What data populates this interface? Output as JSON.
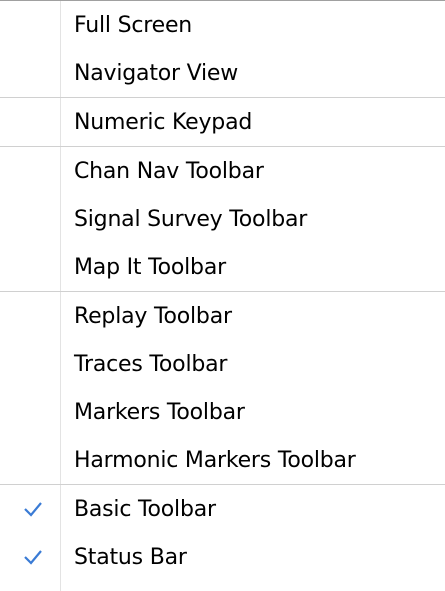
{
  "menu": {
    "check_color": "#3a7bd5",
    "items": [
      {
        "label": "Full Screen",
        "checked": false
      },
      {
        "label": "Navigator View",
        "checked": false
      },
      {
        "label": "Numeric Keypad",
        "checked": false
      },
      {
        "label": "Chan Nav Toolbar",
        "checked": false
      },
      {
        "label": "Signal Survey Toolbar",
        "checked": false
      },
      {
        "label": "Map It Toolbar",
        "checked": false
      },
      {
        "label": "Replay Toolbar",
        "checked": false
      },
      {
        "label": "Traces Toolbar",
        "checked": false
      },
      {
        "label": "Markers Toolbar",
        "checked": false
      },
      {
        "label": "Harmonic Markers Toolbar",
        "checked": false
      },
      {
        "label": "Basic Toolbar",
        "checked": true
      },
      {
        "label": "Status Bar",
        "checked": true
      }
    ]
  }
}
